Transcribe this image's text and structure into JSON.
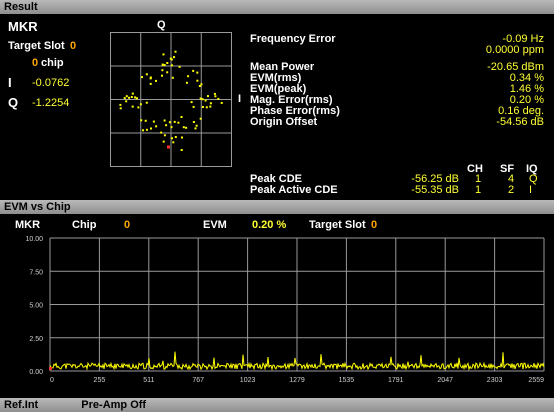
{
  "result": {
    "title": "Result",
    "mkr_label": "MKR",
    "target_slot_label": "Target Slot",
    "target_slot_value": "0",
    "chip_value": "0",
    "chip_label": "chip",
    "i_label": "I",
    "i_value": "-0.0762",
    "q_label": "Q",
    "q_value": "-1.2254",
    "constellation_q": "Q",
    "constellation_i": "I",
    "metrics": [
      {
        "label": "Frequency Error",
        "value": "-0.09 Hz"
      },
      {
        "label": "",
        "value": "0.0000 ppm"
      },
      {
        "label": "Mean Power",
        "value": "-20.65 dBm"
      },
      {
        "label": "EVM(rms)",
        "value": "0.34 %"
      },
      {
        "label": "EVM(peak)",
        "value": "1.46 %"
      },
      {
        "label": "Mag. Error(rms)",
        "value": "0.20 %"
      },
      {
        "label": "Phase Error(rms)",
        "value": "0.16 deg."
      },
      {
        "label": "Origin Offset",
        "value": "-54.56 dB"
      }
    ],
    "cde_headers": {
      "ch": "CH",
      "sf": "SF",
      "iq": "IQ"
    },
    "cde_rows": [
      {
        "label": "Peak CDE",
        "value": "-56.25 dB",
        "ch": "1",
        "sf": "4",
        "iq": "Q"
      },
      {
        "label": "Peak Active CDE",
        "value": "-55.35 dB",
        "ch": "1",
        "sf": "2",
        "iq": "I"
      }
    ]
  },
  "evm_panel": {
    "title": "EVM vs Chip",
    "mkr_label": "MKR",
    "chip_label": "Chip",
    "chip_value": "0",
    "evm_label": "EVM",
    "evm_value": "0.20 %",
    "target_slot_label": "Target Slot",
    "target_slot_value": "0"
  },
  "status": {
    "ref": "Ref.Int",
    "preamp": "Pre-Amp Off"
  },
  "colors": {
    "trace": "#ffff00",
    "marker": "#ff3030",
    "grid": "#9a9a9a",
    "accent": "#ffa500"
  },
  "chart_data": {
    "type": "line",
    "title": "",
    "xlabel": "",
    "ylabel": "",
    "ylim": [
      0,
      10
    ],
    "xlim": [
      0,
      2559
    ],
    "y_ticks": [
      "10.00",
      "7.50",
      "5.00",
      "2.50",
      "0.00"
    ],
    "x_ticks": [
      "0",
      "255",
      "511",
      "767",
      "1023",
      "1279",
      "1535",
      "1791",
      "2047",
      "2303",
      "2559"
    ],
    "series": [
      {
        "approx_level": 0.3,
        "approx_peak": 1.46
      }
    ]
  }
}
